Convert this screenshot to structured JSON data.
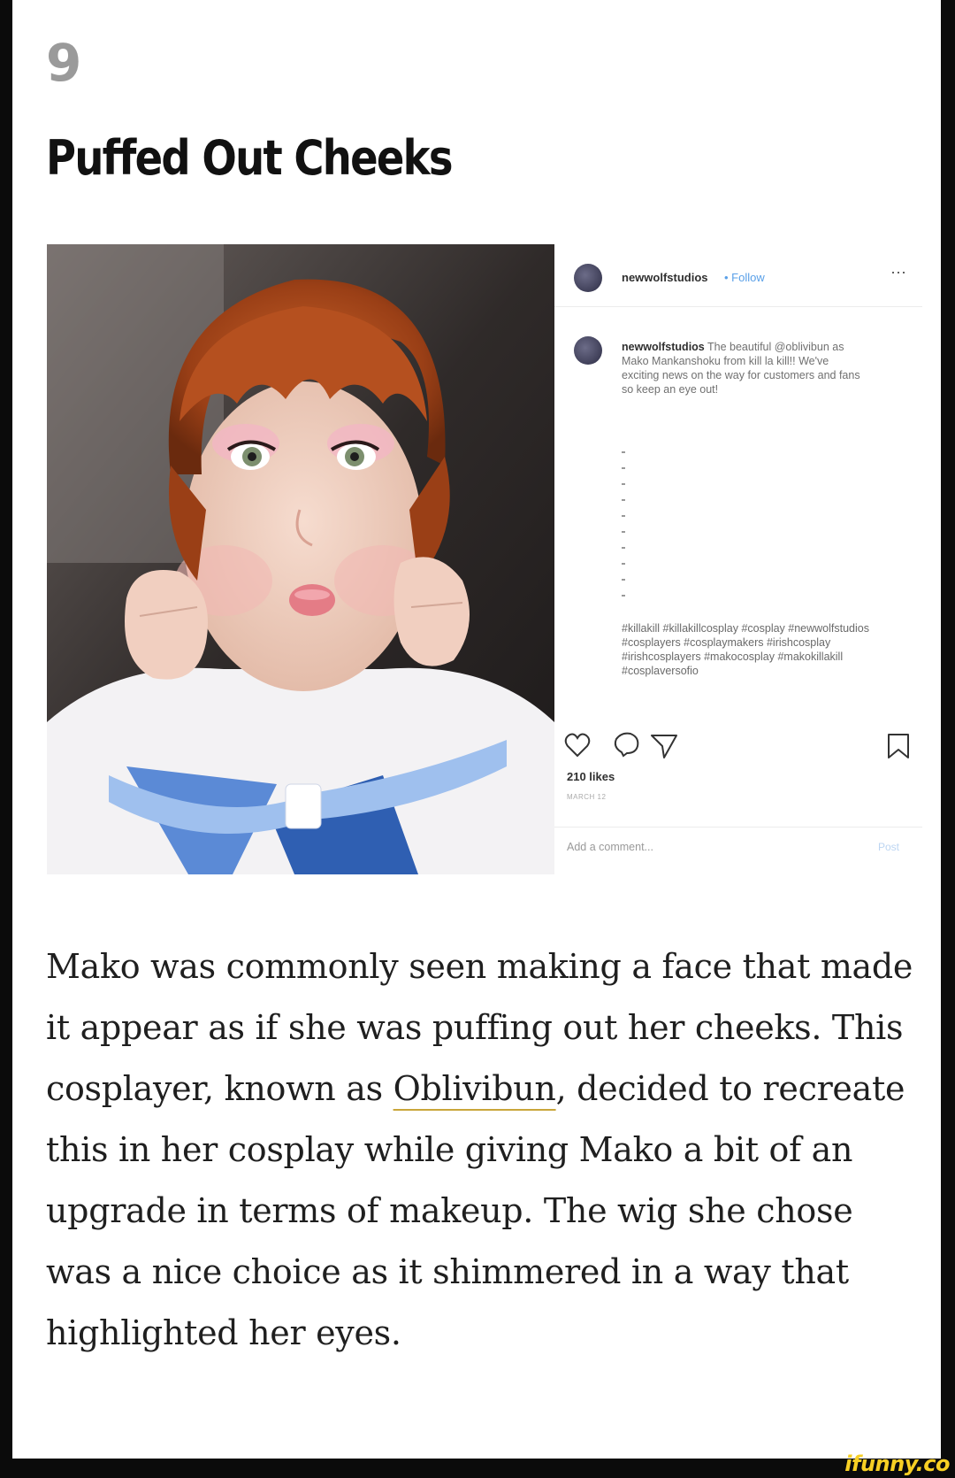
{
  "article": {
    "number": "9",
    "heading": "Puffed Out Cheeks",
    "body_before_link": "Mako was commonly seen making a face that made it appear as if she was puffing out her cheeks. This cosplayer, known as ",
    "link_text": "Oblivibun",
    "body_after_link": ", decided to recreate this in her cosplay while giving Mako a bit of an upgrade in terms of makeup. The wig she chose was a nice choice as it shimmered in a way that highlighted her eyes."
  },
  "instagram_post": {
    "header_username": "newwolfstudios",
    "header_follow": "• Follow",
    "more_icon": "more-dots-icon",
    "caption_username": "newwolfstudios",
    "caption_text": " The beautiful @oblivibun as Mako Mankanshoku from kill la kill!! We've exciting news on the way for customers and fans so keep an eye out!",
    "hashtags": "#killakill #killakillcosplay #cosplay #newwolfstudios #cosplayers #cosplaymakers #irishcosplay #irishcosplayers #makocosplay #makokillakill #cosplaversofio",
    "likes": "210 likes",
    "date": "MARCH 12",
    "add_comment_placeholder": "Add a comment...",
    "post_button": "Post",
    "icons": [
      "heart-icon",
      "comment-icon",
      "share-icon",
      "bookmark-icon"
    ]
  },
  "watermark": "ifunny.co",
  "colors": {
    "background": "#0b0b0b",
    "page": "#ffffff",
    "number": "#9a9a9a",
    "link_underline": "#c9a63a",
    "follow": "#5aa0e8",
    "watermark": "#f7cf24"
  }
}
